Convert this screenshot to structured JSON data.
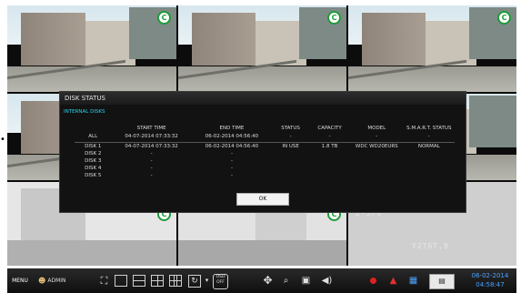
{
  "camera_overlay": {
    "center_label": "2-3/6",
    "lower_label": "Y2T6T,9"
  },
  "dialog": {
    "title": "DISK STATUS",
    "section": "INTERNAL DISKS",
    "columns": [
      "",
      "START TIME",
      "END TIME",
      "STATUS",
      "CAPACITY",
      "MODEL",
      "S.M.A.R.T. STATUS"
    ],
    "rows": [
      [
        "ALL",
        "04-07-2014  07:33:32",
        "06-02-2014  04:56:40",
        "-",
        "-",
        "-",
        "-"
      ],
      [
        "DISK 1",
        "04-07-2014  07:33:32",
        "06-02-2014  04:56:40",
        "IN USE",
        "1.8 TB",
        "WDC WD20EURS",
        "NORMAL"
      ],
      [
        "DISK 2",
        "-",
        "-",
        "",
        "",
        "",
        ""
      ],
      [
        "DISK 3",
        "-",
        "-",
        "",
        "",
        "",
        ""
      ],
      [
        "DISK 4",
        "-",
        "-",
        "",
        "",
        "",
        ""
      ],
      [
        "DISK 5",
        "-",
        "-",
        "",
        "",
        "",
        ""
      ]
    ],
    "ok_label": "OK"
  },
  "taskbar": {
    "menu_label": "MENU",
    "user_label": "ADMIN",
    "osd_label": "OSD\nOFF",
    "date": "06-02-2014",
    "time": "04:58:47"
  }
}
